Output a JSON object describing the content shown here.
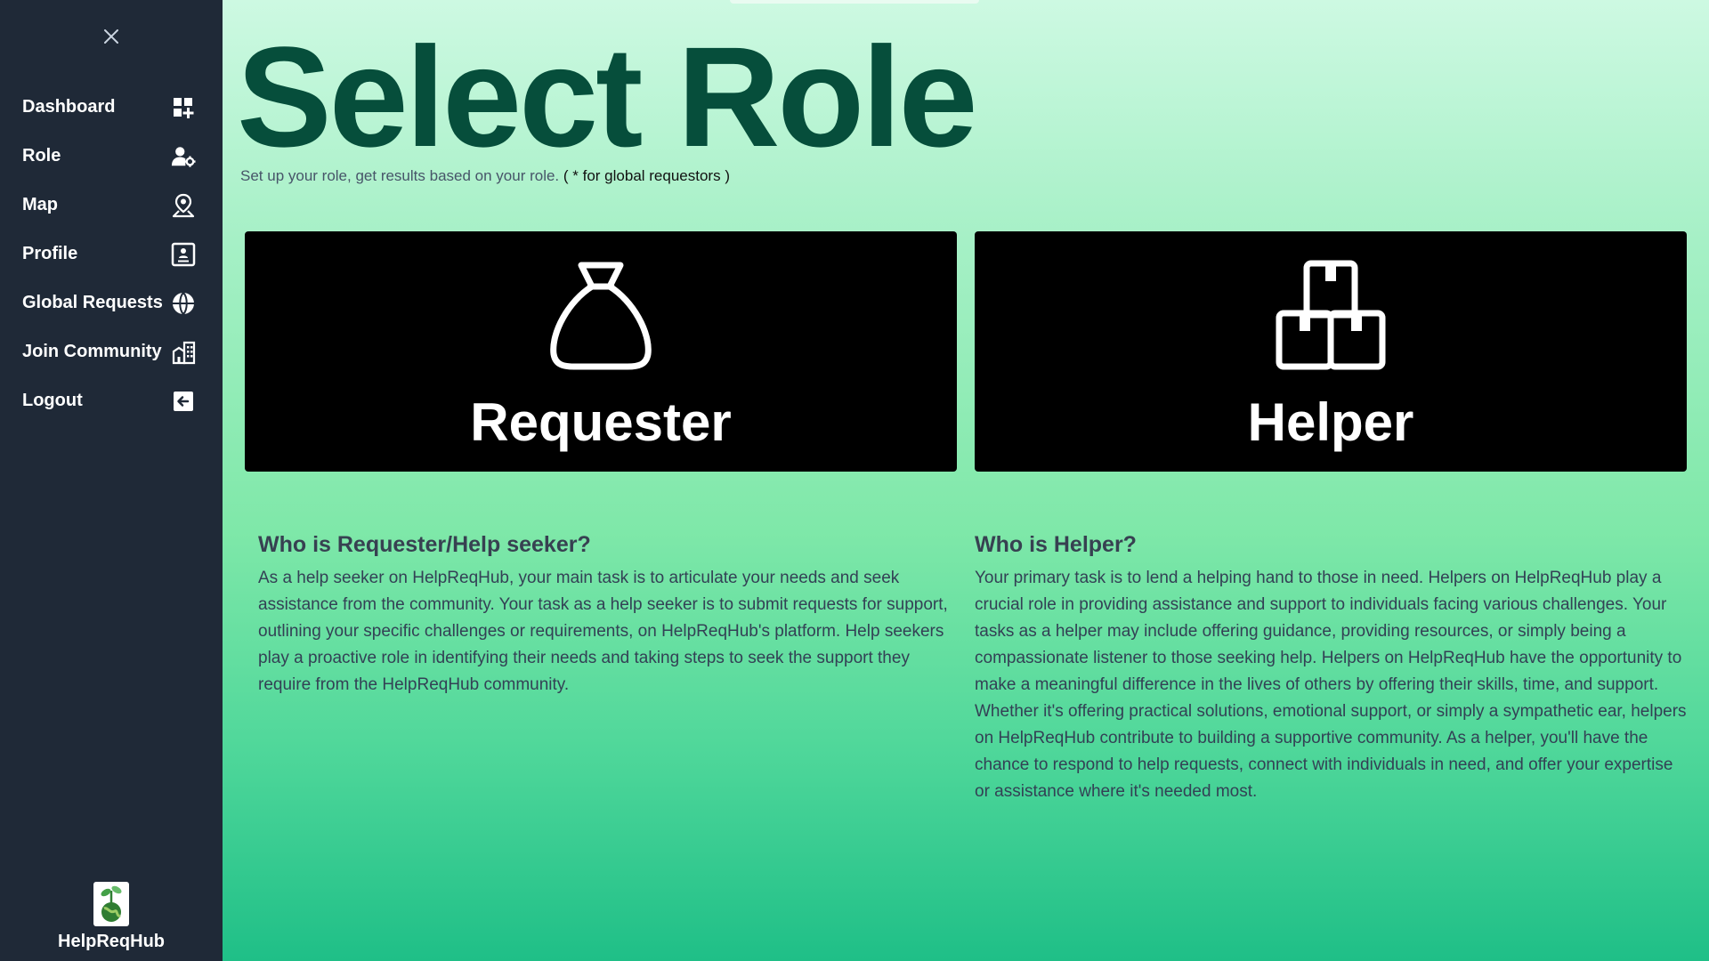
{
  "sidebar": {
    "close_icon": "close-icon",
    "items": [
      {
        "label": "Dashboard",
        "icon": "dashboard-add-icon"
      },
      {
        "label": "Role",
        "icon": "user-settings-icon"
      },
      {
        "label": "Map",
        "icon": "map-pin-user-icon"
      },
      {
        "label": "Profile",
        "icon": "profile-card-icon"
      },
      {
        "label": "Global Requests",
        "icon": "globe-icon"
      },
      {
        "label": "Join Community",
        "icon": "community-building-icon"
      },
      {
        "label": "Logout",
        "icon": "logout-icon"
      }
    ],
    "brand": {
      "name": "HelpReqHub",
      "logo": "plant-globe-logo"
    }
  },
  "main": {
    "title": "Select Role",
    "subtitle": "Set up your role, get results based on your role.",
    "subtitle_note": "( * for global requestors )",
    "roles": [
      {
        "label": "Requester",
        "icon": "money-bag-icon"
      },
      {
        "label": "Helper",
        "icon": "stacked-boxes-icon"
      }
    ],
    "info": {
      "requester": {
        "heading": "Who is Requester/Help seeker?",
        "body": "As a help seeker on HelpReqHub, your main task is to articulate your needs and seek assistance from the community. Your task as a help seeker is to submit requests for support, outlining your specific challenges or requirements, on HelpReqHub's platform. Help seekers play a proactive role in identifying their needs and taking steps to seek the support they require from the HelpReqHub community."
      },
      "helper": {
        "heading": "Who is Helper?",
        "body": "Your primary task is to lend a helping hand to those in need. Helpers on HelpReqHub play a crucial role in providing assistance and support to individuals facing various challenges. Your tasks as a helper may include offering guidance, providing resources, or simply being a compassionate listener to those seeking help. Helpers on HelpReqHub have the opportunity to make a meaningful difference in the lives of others by offering their skills, time, and support. Whether it's offering practical solutions, emotional support, or simply a sympathetic ear, helpers on HelpReqHub contribute to building a supportive community. As a helper, you'll have the chance to respond to help requests, connect with individuals in need, and offer your expertise or assistance where it's needed most."
      }
    }
  },
  "colors": {
    "sidebar_bg": "#1f2937",
    "title": "#064e3b",
    "card_bg": "#000000",
    "gradient_top": "#cdf9e2",
    "gradient_bottom": "#1fbf87"
  }
}
